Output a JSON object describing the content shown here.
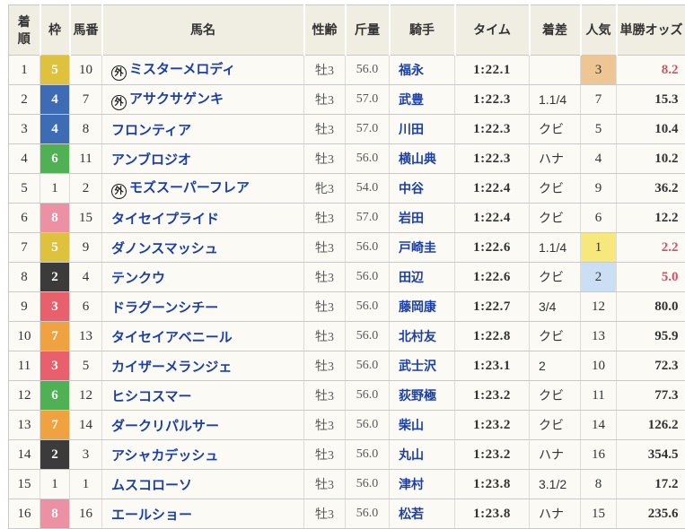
{
  "columns": [
    "着順",
    "枠",
    "馬番",
    "馬名",
    "性齢",
    "斤量",
    "騎手",
    "タイム",
    "着差",
    "人気",
    "単勝オッズ"
  ],
  "outside_mark": "外",
  "colors": {
    "header_bg": "#f0ede3",
    "row_bg": "#fbfaf4",
    "link_blue": "#1b3fa6",
    "odds_hot_red": "#cc5468",
    "waku": {
      "1": "#fbfaf4",
      "2": "#3b3b3b",
      "3": "#e7606b",
      "4": "#3e6cb4",
      "5": "#dec13d",
      "6": "#4fb054",
      "7": "#efa23f",
      "8": "#ec90a4"
    },
    "pop_highlight": {
      "1": "#f6e87c",
      "2": "#cbdff4",
      "3": "#eec694"
    }
  },
  "rows": [
    {
      "rank": "1",
      "waku": "5",
      "num": "10",
      "mark": "外",
      "name": "ミスターメロディ",
      "sex_age": "牡3",
      "weight": "56.0",
      "jockey": "福永",
      "time": "1:22.1",
      "margin": "",
      "pop": "3",
      "pop_hl": "3",
      "odds": "8.2",
      "odds_hot": true
    },
    {
      "rank": "2",
      "waku": "4",
      "num": "7",
      "mark": "外",
      "name": "アサクサゲンキ",
      "sex_age": "牡3",
      "weight": "57.0",
      "jockey": "武豊",
      "time": "1:22.3",
      "margin": "1.1/4",
      "pop": "7",
      "pop_hl": "",
      "odds": "15.3",
      "odds_hot": false
    },
    {
      "rank": "3",
      "waku": "4",
      "num": "8",
      "mark": "",
      "name": "フロンティア",
      "sex_age": "牡3",
      "weight": "57.0",
      "jockey": "川田",
      "time": "1:22.3",
      "margin": "クビ",
      "pop": "5",
      "pop_hl": "",
      "odds": "10.4",
      "odds_hot": false
    },
    {
      "rank": "4",
      "waku": "6",
      "num": "11",
      "mark": "",
      "name": "アンブロジオ",
      "sex_age": "牡3",
      "weight": "56.0",
      "jockey": "横山典",
      "time": "1:22.3",
      "margin": "ハナ",
      "pop": "4",
      "pop_hl": "",
      "odds": "10.2",
      "odds_hot": false
    },
    {
      "rank": "5",
      "waku": "1",
      "num": "2",
      "mark": "外",
      "name": "モズスーパーフレア",
      "sex_age": "牝3",
      "weight": "54.0",
      "jockey": "中谷",
      "time": "1:22.4",
      "margin": "クビ",
      "pop": "9",
      "pop_hl": "",
      "odds": "36.2",
      "odds_hot": false
    },
    {
      "rank": "6",
      "waku": "8",
      "num": "15",
      "mark": "",
      "name": "タイセイプライド",
      "sex_age": "牡3",
      "weight": "57.0",
      "jockey": "岩田",
      "time": "1:22.4",
      "margin": "クビ",
      "pop": "6",
      "pop_hl": "",
      "odds": "12.2",
      "odds_hot": false
    },
    {
      "rank": "7",
      "waku": "5",
      "num": "9",
      "mark": "",
      "name": "ダノンスマッシュ",
      "sex_age": "牡3",
      "weight": "56.0",
      "jockey": "戸崎圭",
      "time": "1:22.6",
      "margin": "1.1/4",
      "pop": "1",
      "pop_hl": "1",
      "odds": "2.2",
      "odds_hot": true
    },
    {
      "rank": "8",
      "waku": "2",
      "num": "4",
      "mark": "",
      "name": "テンクウ",
      "sex_age": "牡3",
      "weight": "56.0",
      "jockey": "田辺",
      "time": "1:22.6",
      "margin": "クビ",
      "pop": "2",
      "pop_hl": "2",
      "odds": "5.0",
      "odds_hot": true
    },
    {
      "rank": "9",
      "waku": "3",
      "num": "6",
      "mark": "",
      "name": "ドラグーンシチー",
      "sex_age": "牡3",
      "weight": "56.0",
      "jockey": "藤岡康",
      "time": "1:22.7",
      "margin": "3/4",
      "pop": "12",
      "pop_hl": "",
      "odds": "80.0",
      "odds_hot": false
    },
    {
      "rank": "10",
      "waku": "7",
      "num": "13",
      "mark": "",
      "name": "タイセイアベニール",
      "sex_age": "牡3",
      "weight": "56.0",
      "jockey": "北村友",
      "time": "1:22.8",
      "margin": "クビ",
      "pop": "13",
      "pop_hl": "",
      "odds": "95.9",
      "odds_hot": false
    },
    {
      "rank": "11",
      "waku": "3",
      "num": "5",
      "mark": "",
      "name": "カイザーメランジェ",
      "sex_age": "牡3",
      "weight": "56.0",
      "jockey": "武士沢",
      "time": "1:23.1",
      "margin": "2",
      "pop": "10",
      "pop_hl": "",
      "odds": "72.3",
      "odds_hot": false
    },
    {
      "rank": "12",
      "waku": "6",
      "num": "12",
      "mark": "",
      "name": "ヒシコスマー",
      "sex_age": "牡3",
      "weight": "56.0",
      "jockey": "荻野極",
      "time": "1:23.2",
      "margin": "クビ",
      "pop": "11",
      "pop_hl": "",
      "odds": "77.3",
      "odds_hot": false
    },
    {
      "rank": "13",
      "waku": "7",
      "num": "14",
      "mark": "",
      "name": "ダークリパルサー",
      "sex_age": "牡3",
      "weight": "56.0",
      "jockey": "柴山",
      "time": "1:23.2",
      "margin": "クビ",
      "pop": "14",
      "pop_hl": "",
      "odds": "126.2",
      "odds_hot": false
    },
    {
      "rank": "14",
      "waku": "2",
      "num": "3",
      "mark": "",
      "name": "アシャカデッシュ",
      "sex_age": "牡3",
      "weight": "56.0",
      "jockey": "丸山",
      "time": "1:23.2",
      "margin": "ハナ",
      "pop": "16",
      "pop_hl": "",
      "odds": "354.5",
      "odds_hot": false
    },
    {
      "rank": "15",
      "waku": "1",
      "num": "1",
      "mark": "",
      "name": "ムスコローソ",
      "sex_age": "牡3",
      "weight": "56.0",
      "jockey": "津村",
      "time": "1:23.8",
      "margin": "3.1/2",
      "pop": "8",
      "pop_hl": "",
      "odds": "17.2",
      "odds_hot": false
    },
    {
      "rank": "16",
      "waku": "8",
      "num": "16",
      "mark": "",
      "name": "エールショー",
      "sex_age": "牡3",
      "weight": "56.0",
      "jockey": "松若",
      "time": "1:23.8",
      "margin": "ハナ",
      "pop": "15",
      "pop_hl": "",
      "odds": "235.6",
      "odds_hot": false
    }
  ]
}
